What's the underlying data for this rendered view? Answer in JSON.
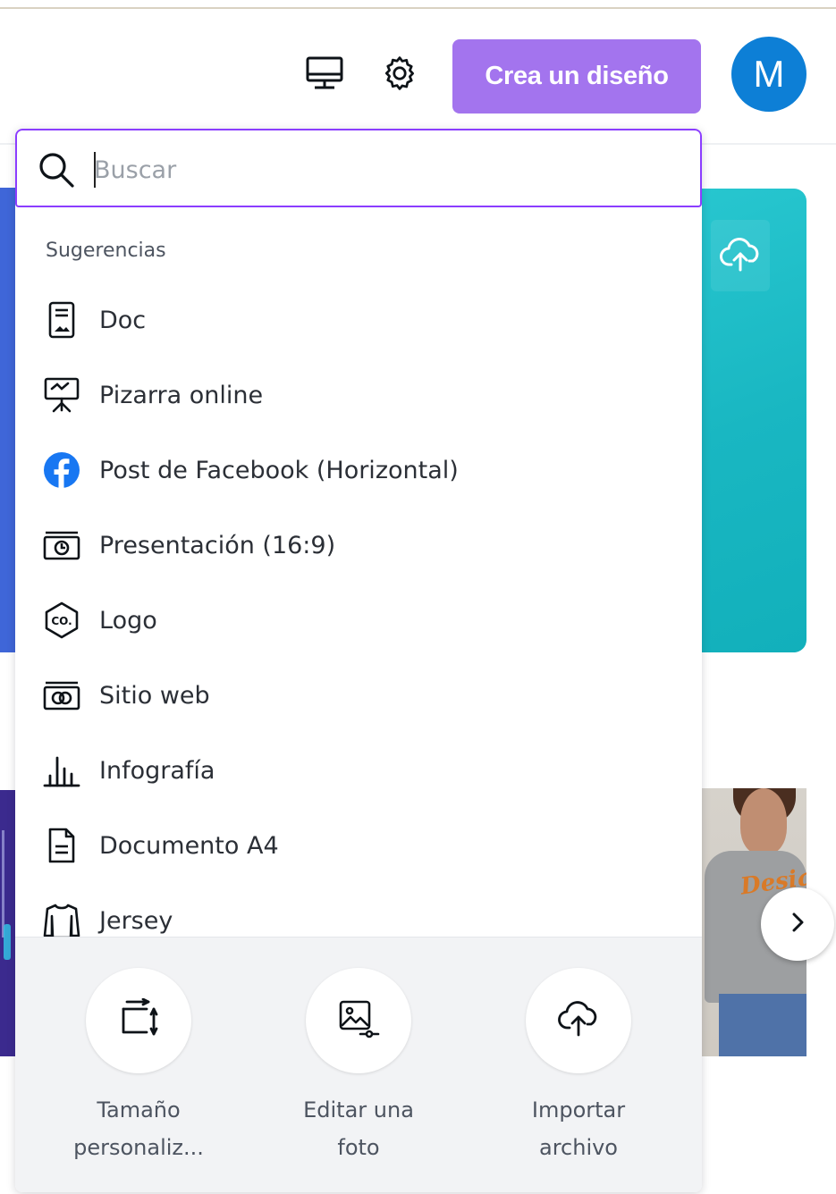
{
  "header": {
    "desktop_icon": "desktop-icon",
    "settings_icon": "gear-icon",
    "create_button": "Crea un diseño",
    "avatar_initial": "M",
    "accent_color": "#a374ee",
    "avatar_color": "#0d7fd6"
  },
  "search": {
    "placeholder": "Buscar",
    "value": "",
    "border_color": "#8b3dff"
  },
  "suggestions": {
    "title": "Sugerencias",
    "items": [
      {
        "label": "Doc",
        "icon": "doc-icon"
      },
      {
        "label": "Pizarra online",
        "icon": "whiteboard-icon"
      },
      {
        "label": "Post de Facebook (Horizontal)",
        "icon": "facebook-icon"
      },
      {
        "label": "Presentación (16:9)",
        "icon": "presentation-icon"
      },
      {
        "label": "Logo",
        "icon": "logo-icon"
      },
      {
        "label": "Sitio web",
        "icon": "website-icon"
      },
      {
        "label": "Infografía",
        "icon": "bar-chart-icon"
      },
      {
        "label": "Documento A4",
        "icon": "document-icon"
      },
      {
        "label": "Jersey",
        "icon": "jersey-icon"
      }
    ]
  },
  "actions": [
    {
      "line1": "Tamaño",
      "line2": "personaliz...",
      "icon": "custom-size-icon"
    },
    {
      "line1": "Editar una",
      "line2": "foto",
      "icon": "edit-photo-icon"
    },
    {
      "line1": "Importar",
      "line2": "archivo",
      "icon": "upload-icon"
    }
  ],
  "background": {
    "banner_text": "Desig"
  }
}
